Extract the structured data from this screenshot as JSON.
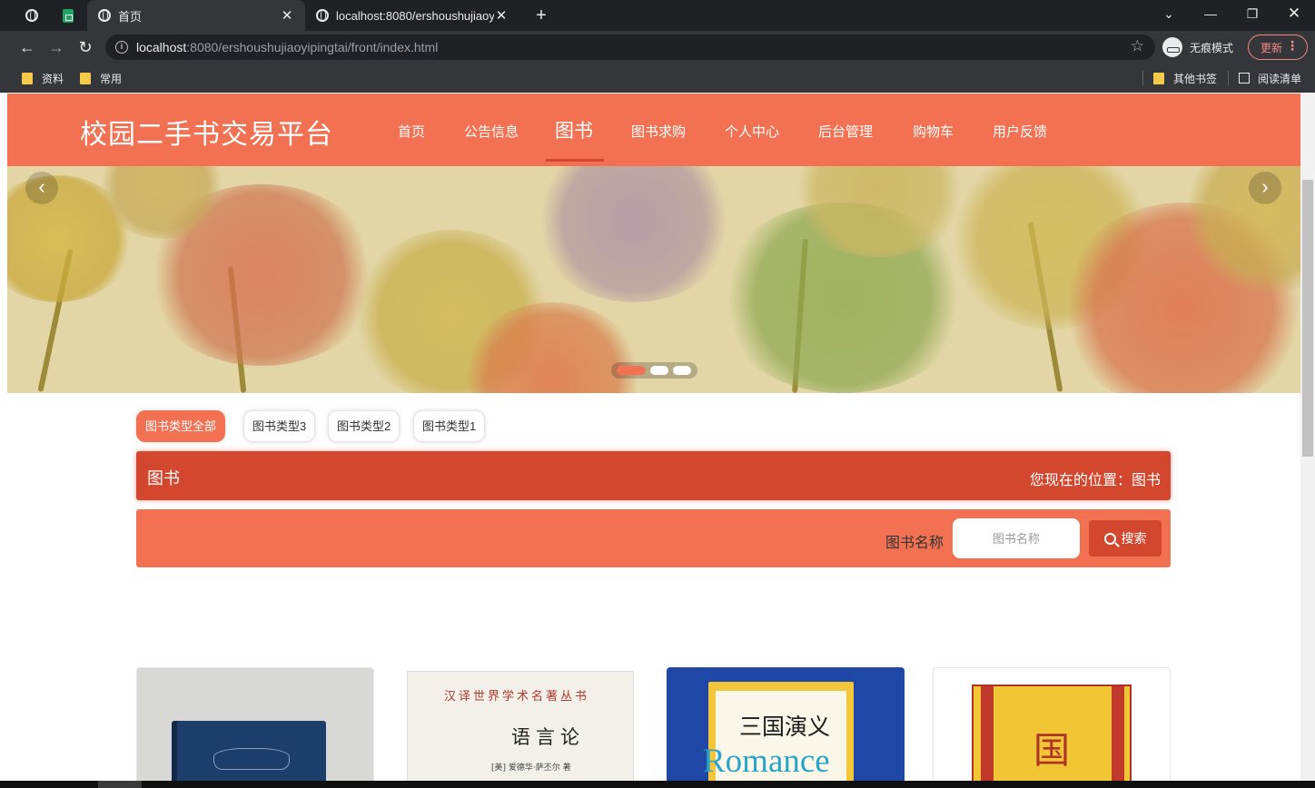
{
  "browser": {
    "tabs": [
      {
        "title": "首页",
        "active": true
      },
      {
        "title": "localhost:8080/ershoushujiaoy",
        "active": false
      }
    ],
    "address": {
      "host": "localhost",
      "rest": ":8080/ershoushujiaoyipingtai/front/index.html"
    },
    "profile_label": "无痕模式",
    "update_label": "更新",
    "bookmarks": [
      "资料",
      "常用"
    ],
    "other_bookmarks": "其他书签",
    "reading_list": "阅读清单"
  },
  "site": {
    "title": "校园二手书交易平台",
    "nav": [
      "首页",
      "公告信息",
      "图书",
      "图书求购",
      "个人中心",
      "后台管理",
      "购物车",
      "用户反馈"
    ],
    "active_nav": "图书"
  },
  "carousel": {
    "slide_count": 3,
    "active_index": 0
  },
  "types": [
    "图书类型全部",
    "图书类型3",
    "图书类型2",
    "图书类型1"
  ],
  "breadcrumb": {
    "title": "图书",
    "location": "您现在的位置：图书"
  },
  "search": {
    "label": "图书名称",
    "placeholder": "图书名称",
    "button": "搜索"
  },
  "books": [
    {
      "cover_color": "#1d3d6b"
    },
    {
      "cover_lines": [
        "汉译世界学术名著丛书",
        "语言论",
        "[美] 爱德华·萨丕尔 著"
      ]
    },
    {
      "cover_lines": [
        "三国演义",
        "Romance"
      ]
    },
    {
      "cover_lines": [
        "国"
      ]
    }
  ],
  "colors": {
    "primary": "#f27152",
    "dark": "#d4472f"
  }
}
